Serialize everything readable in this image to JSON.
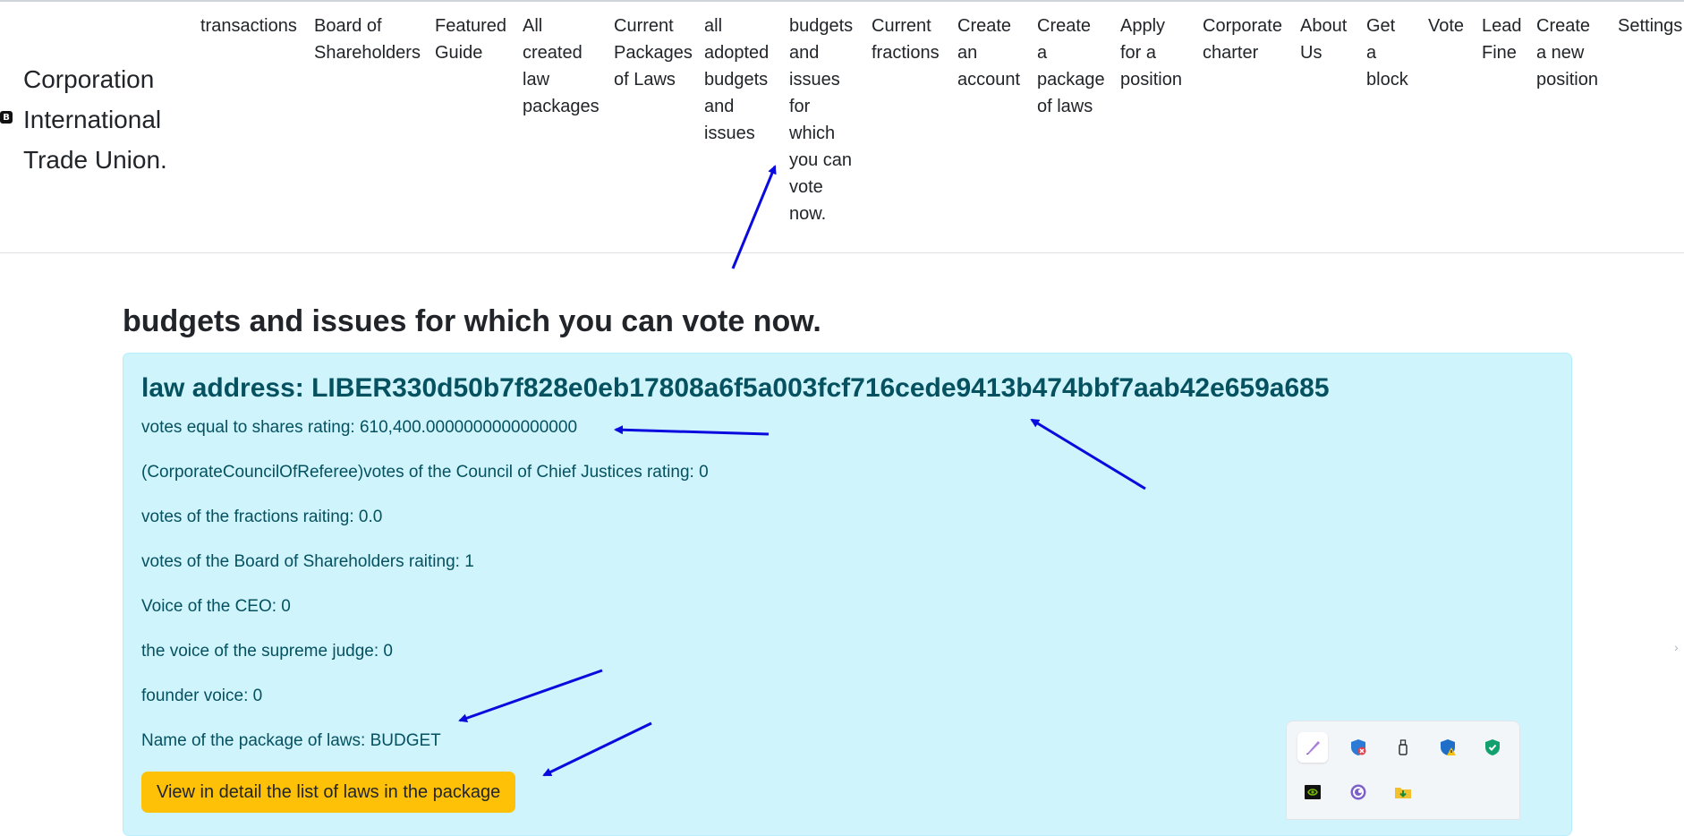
{
  "brand": {
    "badge": "B",
    "lines": [
      "Corporation",
      "International",
      "Trade Union."
    ]
  },
  "nav": [
    {
      "lines": [
        "transactions"
      ]
    },
    {
      "lines": [
        "Board of",
        "Shareholders"
      ]
    },
    {
      "lines": [
        "Featured",
        "Guide"
      ]
    },
    {
      "lines": [
        "All",
        "created",
        "law",
        "packages"
      ]
    },
    {
      "lines": [
        "Current",
        "Packages",
        "of Laws"
      ]
    },
    {
      "lines": [
        "all",
        "adopted",
        "budgets",
        "and",
        "issues"
      ]
    },
    {
      "lines": [
        "budgets",
        "and",
        "issues",
        "for",
        "which",
        "you can",
        "vote",
        "now."
      ]
    },
    {
      "lines": [
        "Current",
        "fractions"
      ]
    },
    {
      "lines": [
        "Create",
        "an",
        "account"
      ]
    },
    {
      "lines": [
        "Create a",
        "package",
        "of laws"
      ]
    },
    {
      "lines": [
        "Apply",
        "for a",
        "position"
      ]
    },
    {
      "lines": [
        "Corporate",
        "charter"
      ]
    },
    {
      "lines": [
        "About",
        "Us"
      ]
    },
    {
      "lines": [
        "Get a",
        "block"
      ]
    },
    {
      "lines": [
        "Vote"
      ]
    },
    {
      "lines": [
        "Lead",
        "Fine"
      ]
    },
    {
      "lines": [
        "Create",
        "a new",
        "position"
      ]
    },
    {
      "lines": [
        "Settings"
      ]
    }
  ],
  "page": {
    "title": "budgets and issues for which you can vote now."
  },
  "card": {
    "law_address": "law address: LIBER330d50b7f828e0eb17808a6f5a003fcf716cede9413b474bbf7aab42e659a685",
    "rows": [
      "votes equal to shares rating: 610,400.0000000000000000",
      "(CorporateCouncilOfReferee)votes of the Council of Chief Justices rating: 0",
      "votes of the fractions raiting: 0.0",
      "votes of the Board of Shareholders raiting: 1",
      "Voice of the CEO: 0",
      "the voice of the supreme judge: 0",
      "founder voice: 0",
      "Name of the package of laws: BUDGET"
    ],
    "detail_button": "View in detail the list of laws in the package"
  },
  "tray": {
    "icons": [
      "pen-icon",
      "shield-blocked-icon",
      "usb-drive-icon",
      "shield-warning-icon",
      "security-check-icon",
      "nvidia-icon",
      "torrent-icon",
      "folder-download-icon"
    ]
  },
  "colors": {
    "card_bg": "#cff4fc",
    "card_text": "#055160",
    "button_bg": "#ffc107",
    "annotation_arrow": "#0a0adf"
  }
}
